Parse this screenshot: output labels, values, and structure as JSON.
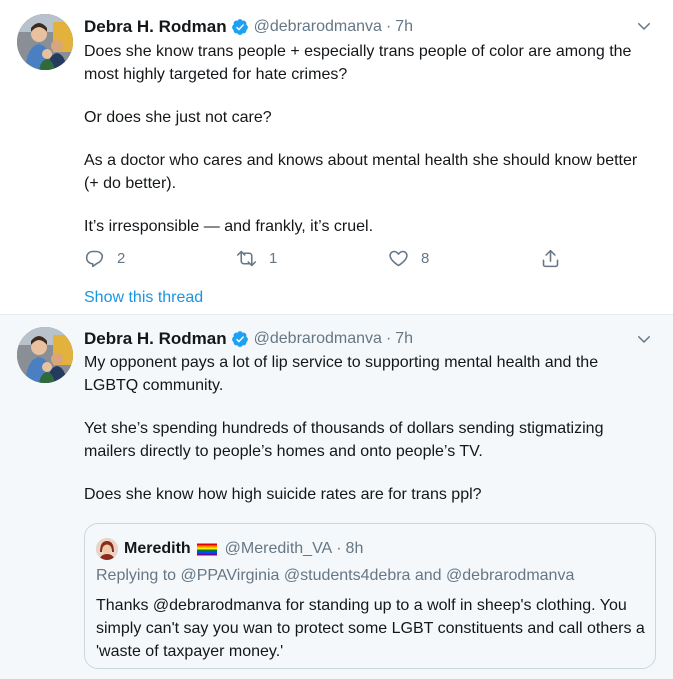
{
  "tweets": [
    {
      "name": "Debra H. Rodman",
      "handle": "@debrarodmanva",
      "separator": "·",
      "time": "7h",
      "paragraphs": [
        "Does she know trans people + especially trans people of color are among the most highly targeted for hate crimes?",
        "Or does she just not care?",
        "As a doctor who cares and knows about mental health she should know better (+ do better).",
        "It’s irresponsible — and frankly, it’s cruel."
      ],
      "reply_count": "2",
      "retweet_count": "1",
      "like_count": "8",
      "show_thread": "Show this thread"
    },
    {
      "name": "Debra H. Rodman",
      "handle": "@debrarodmanva",
      "separator": "·",
      "time": "7h",
      "paragraphs": [
        "My opponent pays a lot of lip service to supporting mental health and the LGBTQ community.",
        "Yet she’s spending hundreds of thousands of dollars sending stigmatizing mailers directly to people’s homes and onto people’s TV.",
        "Does she know how high suicide rates are for trans ppl?"
      ],
      "quote": {
        "name": "Meredith",
        "handle": "@Meredith_VA",
        "separator": "·",
        "time": "8h",
        "replying": "Replying to @PPAVirginia @students4debra and @debrarodmanva",
        "text": "Thanks @debrarodmanva for standing up to a wolf in sheep's clothing. You simply can't say you wan to protect some LGBT constituents and call others a 'waste of taxpayer money.'"
      }
    }
  ],
  "icons": {
    "verified": "verified-badge-icon",
    "caret": "chevron-down-icon",
    "reply": "reply-icon",
    "retweet": "retweet-icon",
    "like": "heart-icon",
    "share": "share-icon",
    "flag": "rainbow-flag-icon"
  },
  "colors": {
    "link": "#1b95e0",
    "secondary_text": "#657786",
    "verified": "#1da1f2",
    "thread_background": "#f5f8fa"
  }
}
